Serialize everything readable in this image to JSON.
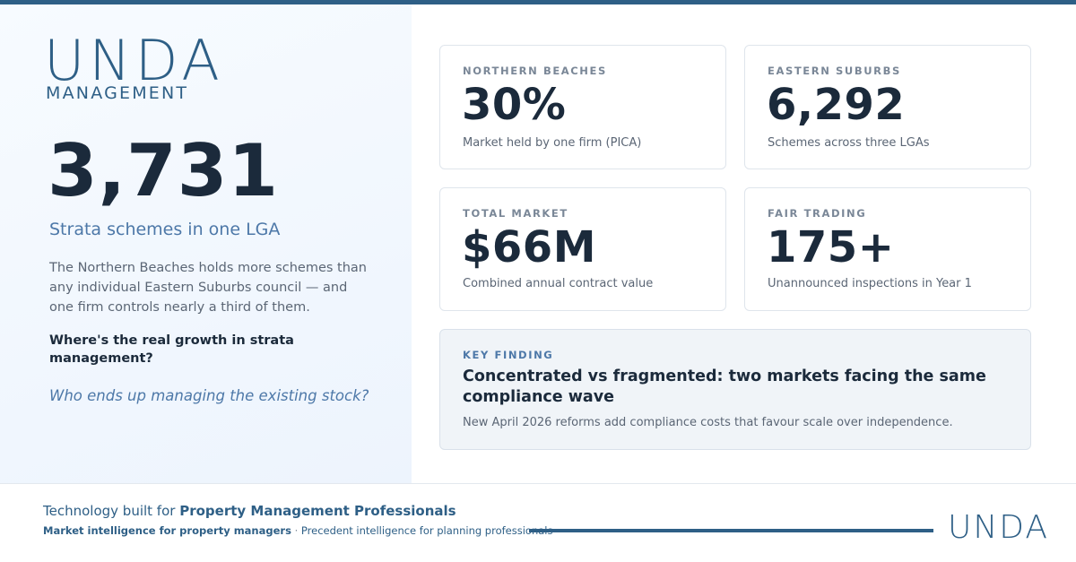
{
  "brand": {
    "logo_word": "UNDA",
    "logo_sub": "MANAGEMENT",
    "color": "#2e5f86"
  },
  "hero": {
    "number": "3,731",
    "subtitle": "Strata schemes in one LGA",
    "lede": "The Northern Beaches holds more schemes than any individual Eastern Suburbs council — and one firm controls nearly a third of them.",
    "question": "Where's the real growth in strata management?",
    "italic_question": "Who ends up managing the existing stock?"
  },
  "stats": [
    {
      "label": "NORTHERN BEACHES",
      "value": "30%",
      "caption": "Market held by one firm (PICA)"
    },
    {
      "label": "EASTERN SUBURBS",
      "value": "6,292",
      "caption": "Schemes across three LGAs"
    },
    {
      "label": "TOTAL MARKET",
      "value": "$66M",
      "caption": "Combined annual contract value"
    },
    {
      "label": "FAIR TRADING",
      "value": "175+",
      "caption": "Unannounced inspections in Year 1"
    }
  ],
  "finding": {
    "label": "KEY FINDING",
    "headline": "Concentrated vs fragmented: two markets facing the same compliance wave",
    "note": "New April 2026 reforms add compliance costs that favour scale over independence."
  },
  "footer": {
    "tagline_prefix": "Technology built for",
    "tagline_bold": "Property Management Professionals",
    "sub_bold": "Market intelligence for property managers",
    "sub_sep": "·",
    "sub_rest": "Precedent intelligence for planning professionals",
    "mark": "UNDA"
  }
}
